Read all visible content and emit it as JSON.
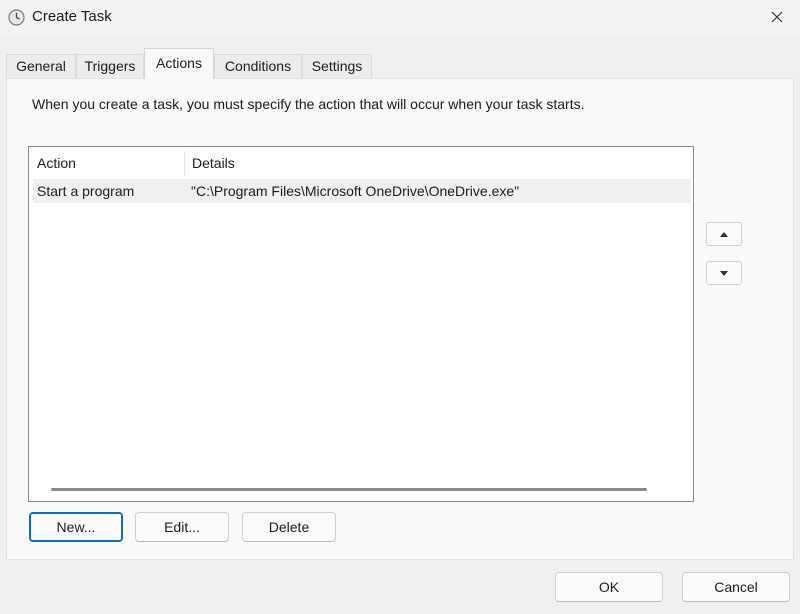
{
  "window": {
    "title": "Create Task"
  },
  "tabs": [
    {
      "label": "General"
    },
    {
      "label": "Triggers"
    },
    {
      "label": "Actions"
    },
    {
      "label": "Conditions"
    },
    {
      "label": "Settings"
    }
  ],
  "actions_panel": {
    "description": "When you create a task, you must specify the action that will occur when your task starts.",
    "columns": [
      "Action",
      "Details"
    ],
    "rows": [
      {
        "action": "Start a program",
        "details": "\"C:\\Program Files\\Microsoft OneDrive\\OneDrive.exe\""
      }
    ],
    "buttons": {
      "new": "New...",
      "edit": "Edit...",
      "delete": "Delete"
    }
  },
  "dialog_buttons": {
    "ok": "OK",
    "cancel": "Cancel"
  },
  "colors": {
    "accent": "#0f6cbd",
    "panel": "#f9f9f9",
    "background": "#f0f0f0"
  }
}
